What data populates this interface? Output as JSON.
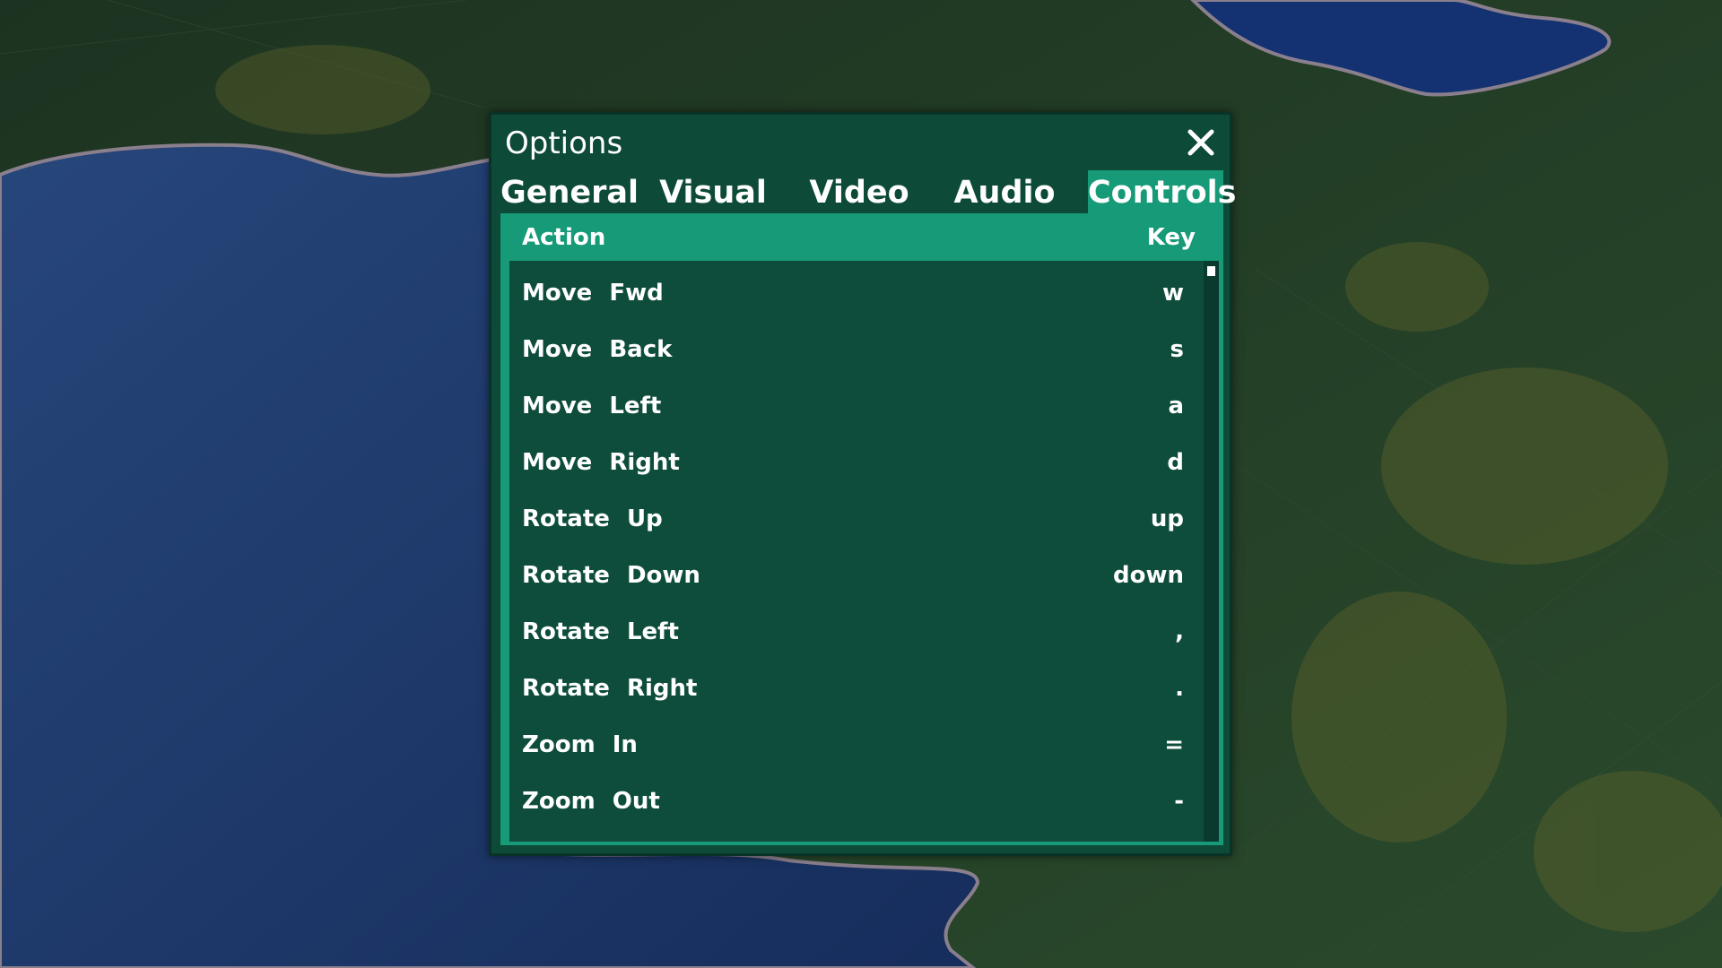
{
  "dialog": {
    "title": "Options",
    "close_icon": "close-icon"
  },
  "tabs": [
    {
      "label": "General",
      "active": false
    },
    {
      "label": "Visual",
      "active": false
    },
    {
      "label": "Video",
      "active": false
    },
    {
      "label": "Audio",
      "active": false
    },
    {
      "label": "Controls",
      "active": true
    }
  ],
  "controls": {
    "header": {
      "action": "Action",
      "key": "Key"
    },
    "rows": [
      {
        "action": "Move Fwd",
        "key": "w"
      },
      {
        "action": "Move Back",
        "key": "s"
      },
      {
        "action": "Move Left",
        "key": "a"
      },
      {
        "action": "Move Right",
        "key": "d"
      },
      {
        "action": "Rotate Up",
        "key": "up"
      },
      {
        "action": "Rotate Down",
        "key": "down"
      },
      {
        "action": "Rotate Left",
        "key": ","
      },
      {
        "action": "Rotate Right",
        "key": "."
      },
      {
        "action": "Zoom In",
        "key": "="
      },
      {
        "action": "Zoom Out",
        "key": "-"
      }
    ]
  },
  "colors": {
    "dialog_bg": "#0d4a38",
    "active_tab": "#169a78",
    "list_bg": "#0e4d3c",
    "water": "#1b3a6b",
    "land": "#233f29"
  }
}
